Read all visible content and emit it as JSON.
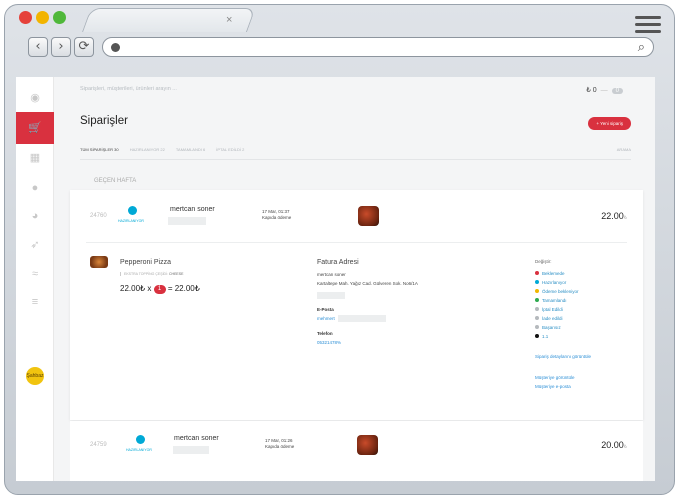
{
  "browser": {
    "back": "‹",
    "forward": "›",
    "reload": "⟳",
    "search_icon": "⌕",
    "tab_close": "×"
  },
  "search": {
    "placeholder": "Siparişleri, müşterileri, ürünleri arayın ..."
  },
  "topbar": {
    "balance": "₺ 0",
    "count": "0"
  },
  "sidebar": {
    "logo_label": "Şahbaz"
  },
  "page": {
    "title": "Siparişler",
    "new_order": "+ Yeni sipariş",
    "tabs": [
      "TÜM SİPARİŞLER 30",
      "HAZIRLANIYOR 22",
      "TAMAMLANDI 6",
      "İPTAL EDİLDİ 2"
    ],
    "search_tab": "ARAMA",
    "week": "GEÇEN HAFTA"
  },
  "orders": [
    {
      "id": "24760",
      "status": "HAZIRLANIYOR",
      "status_color": "#00a9d6",
      "customer": "mertcan soner",
      "date": "17 Mar, 01:37",
      "payment": "Kapıda ödeme",
      "total": "22.00",
      "currency": "₺"
    },
    {
      "id": "24759",
      "status": "HAZIRLANIYOR",
      "status_color": "#00a9d6",
      "customer": "mertcan soner",
      "date": "17 Mar, 01:26",
      "payment": "Kapıda ödeme",
      "total": "20.00",
      "currency": "₺"
    }
  ],
  "detail": {
    "product": {
      "name": "Pepperoni Pizza",
      "topping_label": "EKSTRA TOPPİNG ÇEŞİDİ:",
      "topping_value": "CHEESE",
      "price": "22.00₺",
      "x": "x",
      "qty": "1",
      "equals": "= 22.00₺"
    },
    "invoice": {
      "title": "Fatura Adresi",
      "name": "mertcan soner",
      "address": "Kartaltepe Mah. Yağız Cad. Gülveren Sok. No6/1A",
      "email_label": "E-Posta",
      "email_value": "mehmert",
      "phone_label": "Telefon",
      "phone_value": "05321478%"
    },
    "status_header": "Değiştir:",
    "statuses": [
      {
        "label": "Beklemede",
        "color": "#d9313f"
      },
      {
        "label": "Hazırlanıyor",
        "color": "#00a9d6"
      },
      {
        "label": "Ödeme bekleniyor",
        "color": "#f1b700"
      },
      {
        "label": "Tamamlandı",
        "color": "#2eaa4f"
      },
      {
        "label": "İptal Edildi",
        "color": "#b5b9bd"
      },
      {
        "label": "İade edildi",
        "color": "#b5b9bd"
      },
      {
        "label": "Başarısız",
        "color": "#b5b9bd"
      },
      {
        "label": "1.1",
        "color": "#111111"
      }
    ],
    "links": {
      "details": "Sipariş detaylarını görüntüle",
      "customer": "Müşteriye görüntüle",
      "mail": "Müşteriye e-posta"
    }
  }
}
